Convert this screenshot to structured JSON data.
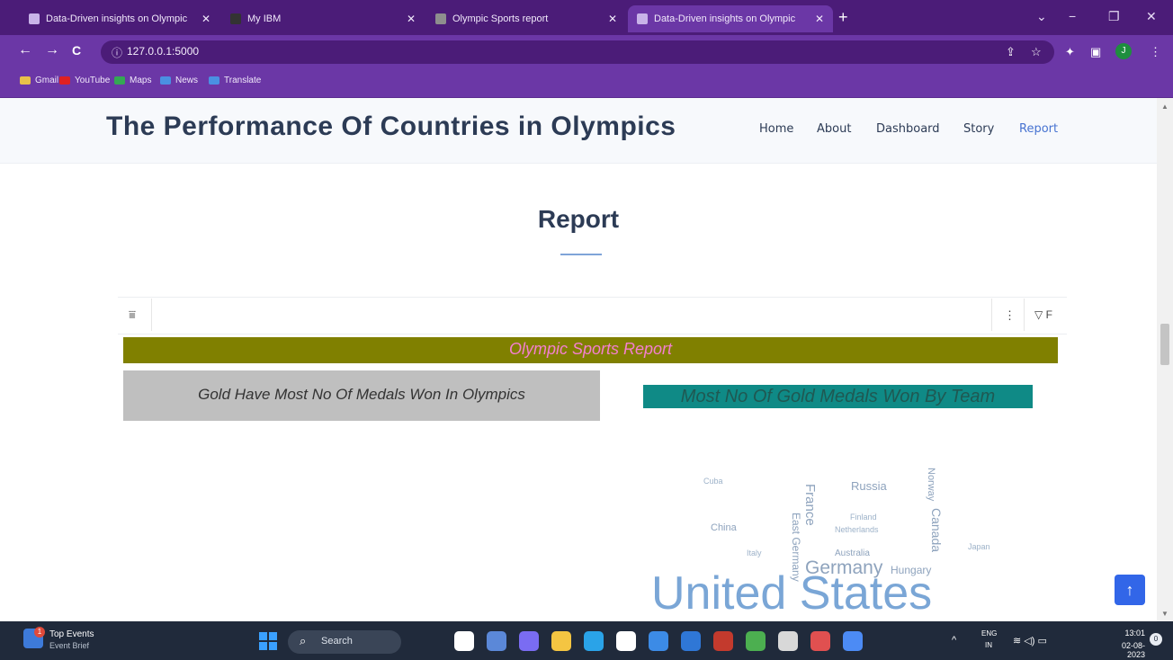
{
  "browser": {
    "tabs": [
      {
        "title": "Data-Driven insights on Olympic",
        "fav_color": "#c8b3e8",
        "active": false
      },
      {
        "title": "My IBM",
        "fav_color": "#333333",
        "active": false
      },
      {
        "title": "Olympic Sports report",
        "fav_color": "#8e8e8e",
        "active": false
      },
      {
        "title": "Data-Driven insights on Olympic",
        "fav_color": "#c8b3e8",
        "active": true
      }
    ],
    "new_tab": "+",
    "window_controls": {
      "minimize": "−",
      "restore": "❐",
      "close": "✕",
      "tab_search": "⌄"
    },
    "nav": {
      "back": "←",
      "forward": "→",
      "reload": "C"
    },
    "url_icon": "ⓘ",
    "url": "127.0.0.1:5000",
    "profile_initial": "J",
    "bookmarks": [
      {
        "label": "Gmail",
        "color": "#e8c04a"
      },
      {
        "label": "YouTube",
        "color": "#e02020"
      },
      {
        "label": "Maps",
        "color": "#34a853"
      },
      {
        "label": "News",
        "color": "#4a90e2"
      },
      {
        "label": "Translate",
        "color": "#4a90e2"
      }
    ]
  },
  "site": {
    "title": "The Performance Of Countries in Olympics",
    "nav": [
      "Home",
      "About",
      "Dashboard",
      "Story",
      "Report"
    ],
    "active_nav": "Report",
    "section_heading": "Report"
  },
  "report": {
    "toolbar_filter_label": "F",
    "banner": "Olympic Sports Report",
    "card_left": "Gold Have Most No Of Medals Won In Olympics",
    "card_right": "Most No Of Gold Medals Won By Team",
    "wordcloud_words": [
      "United States",
      "Germany",
      "Hungary",
      "Russia",
      "France",
      "China",
      "Netherlands",
      "Australia",
      "East Germany",
      "Norway",
      "Canada",
      "Japan",
      "Finland",
      "Cuba",
      "Italy"
    ],
    "scroll_top": "↑"
  },
  "taskbar": {
    "weather_title": "Top Events",
    "weather_sub": "Event Brief",
    "badge": "1",
    "search_label": "Search",
    "lang_line1": "ENG",
    "lang_line2": "IN",
    "time": "13:01",
    "date": "02-08-2023",
    "notification_count": "0",
    "app_colors": [
      "#ffffff",
      "#5b88d8",
      "#7a6cf2",
      "#f4c542",
      "#2aa3e8",
      "#ffffff",
      "#3c8be6",
      "#2f77d6",
      "#c33a2d",
      "#4caf50",
      "#d8d8d8",
      "#e05050",
      "#4c8bf5"
    ]
  },
  "colors": {
    "tabbar": "#4b1c78",
    "toolbar": "#6b37a6",
    "banner_bg": "#808000",
    "banner_text": "#f47fd0",
    "card_right_bg": "#0f8a86",
    "accent": "#3266e8"
  }
}
